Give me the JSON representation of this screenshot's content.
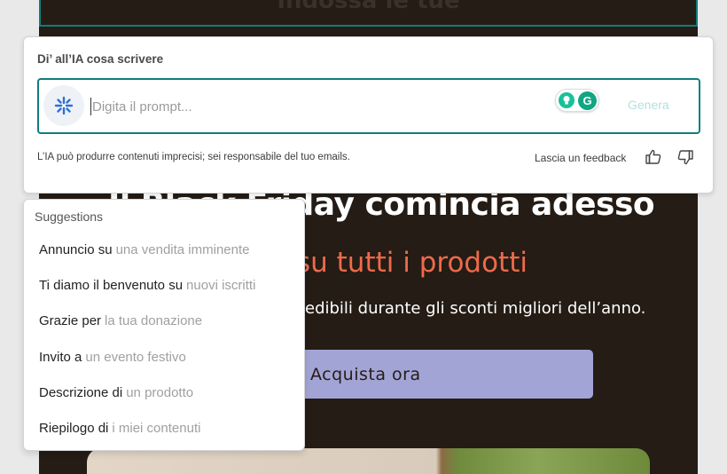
{
  "email_preview": {
    "top_banner_text": "Indossa le tue",
    "headline": "Il Black Friday comincia adesso",
    "subheadline": "su tutti i prodotti",
    "body": "edibili durante gli sconti migliori dell’anno.",
    "cta_label": "Acquista ora"
  },
  "ai_panel": {
    "title": "Di’ all’IA cosa scrivere",
    "prompt_placeholder": "Digita il prompt...",
    "prompt_value": "",
    "generate_label": "Genera",
    "grammarly_letter": "G",
    "disclaimer": "L’IA può produrre contenuti imprecisi; sei responsabile del tuo emails.",
    "feedback_label": "Lascia un feedback",
    "accent_color": "#0f7d7e"
  },
  "suggestions": {
    "title": "Suggestions",
    "items": [
      {
        "lead": "Annuncio su",
        "rest": "una vendita imminente"
      },
      {
        "lead": "Ti diamo il benvenuto su",
        "rest": "nuovi iscritti"
      },
      {
        "lead": "Grazie per",
        "rest": "la tua donazione"
      },
      {
        "lead": "Invito a",
        "rest": "un evento festivo"
      },
      {
        "lead": "Descrizione di",
        "rest": "un prodotto"
      },
      {
        "lead": "Riepilogo di",
        "rest": "i miei contenuti"
      }
    ]
  }
}
